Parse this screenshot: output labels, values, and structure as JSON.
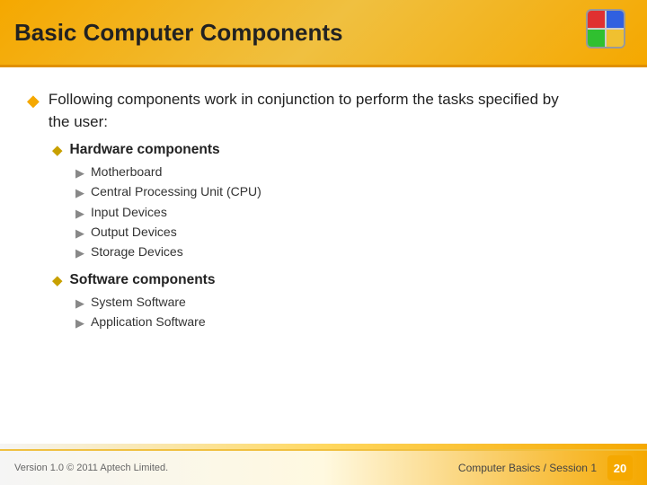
{
  "header": {
    "title": "Basic Computer Components"
  },
  "content": {
    "level1_bullet": "◆",
    "intro_text_line1": "Following components work in conjunction to perform the tasks specified by",
    "intro_text_line2": "the user:",
    "sections": [
      {
        "label": "Hardware components",
        "items": [
          "Motherboard",
          "Central Processing Unit (CPU)",
          "Input Devices",
          "Output Devices",
          "Storage Devices"
        ]
      },
      {
        "label": "Software components",
        "items": [
          "System Software",
          "Application Software"
        ]
      }
    ]
  },
  "footer": {
    "version": "Version 1.0 © 2011 Aptech Limited.",
    "course": "Computer Basics / Session 1",
    "page": "20"
  }
}
